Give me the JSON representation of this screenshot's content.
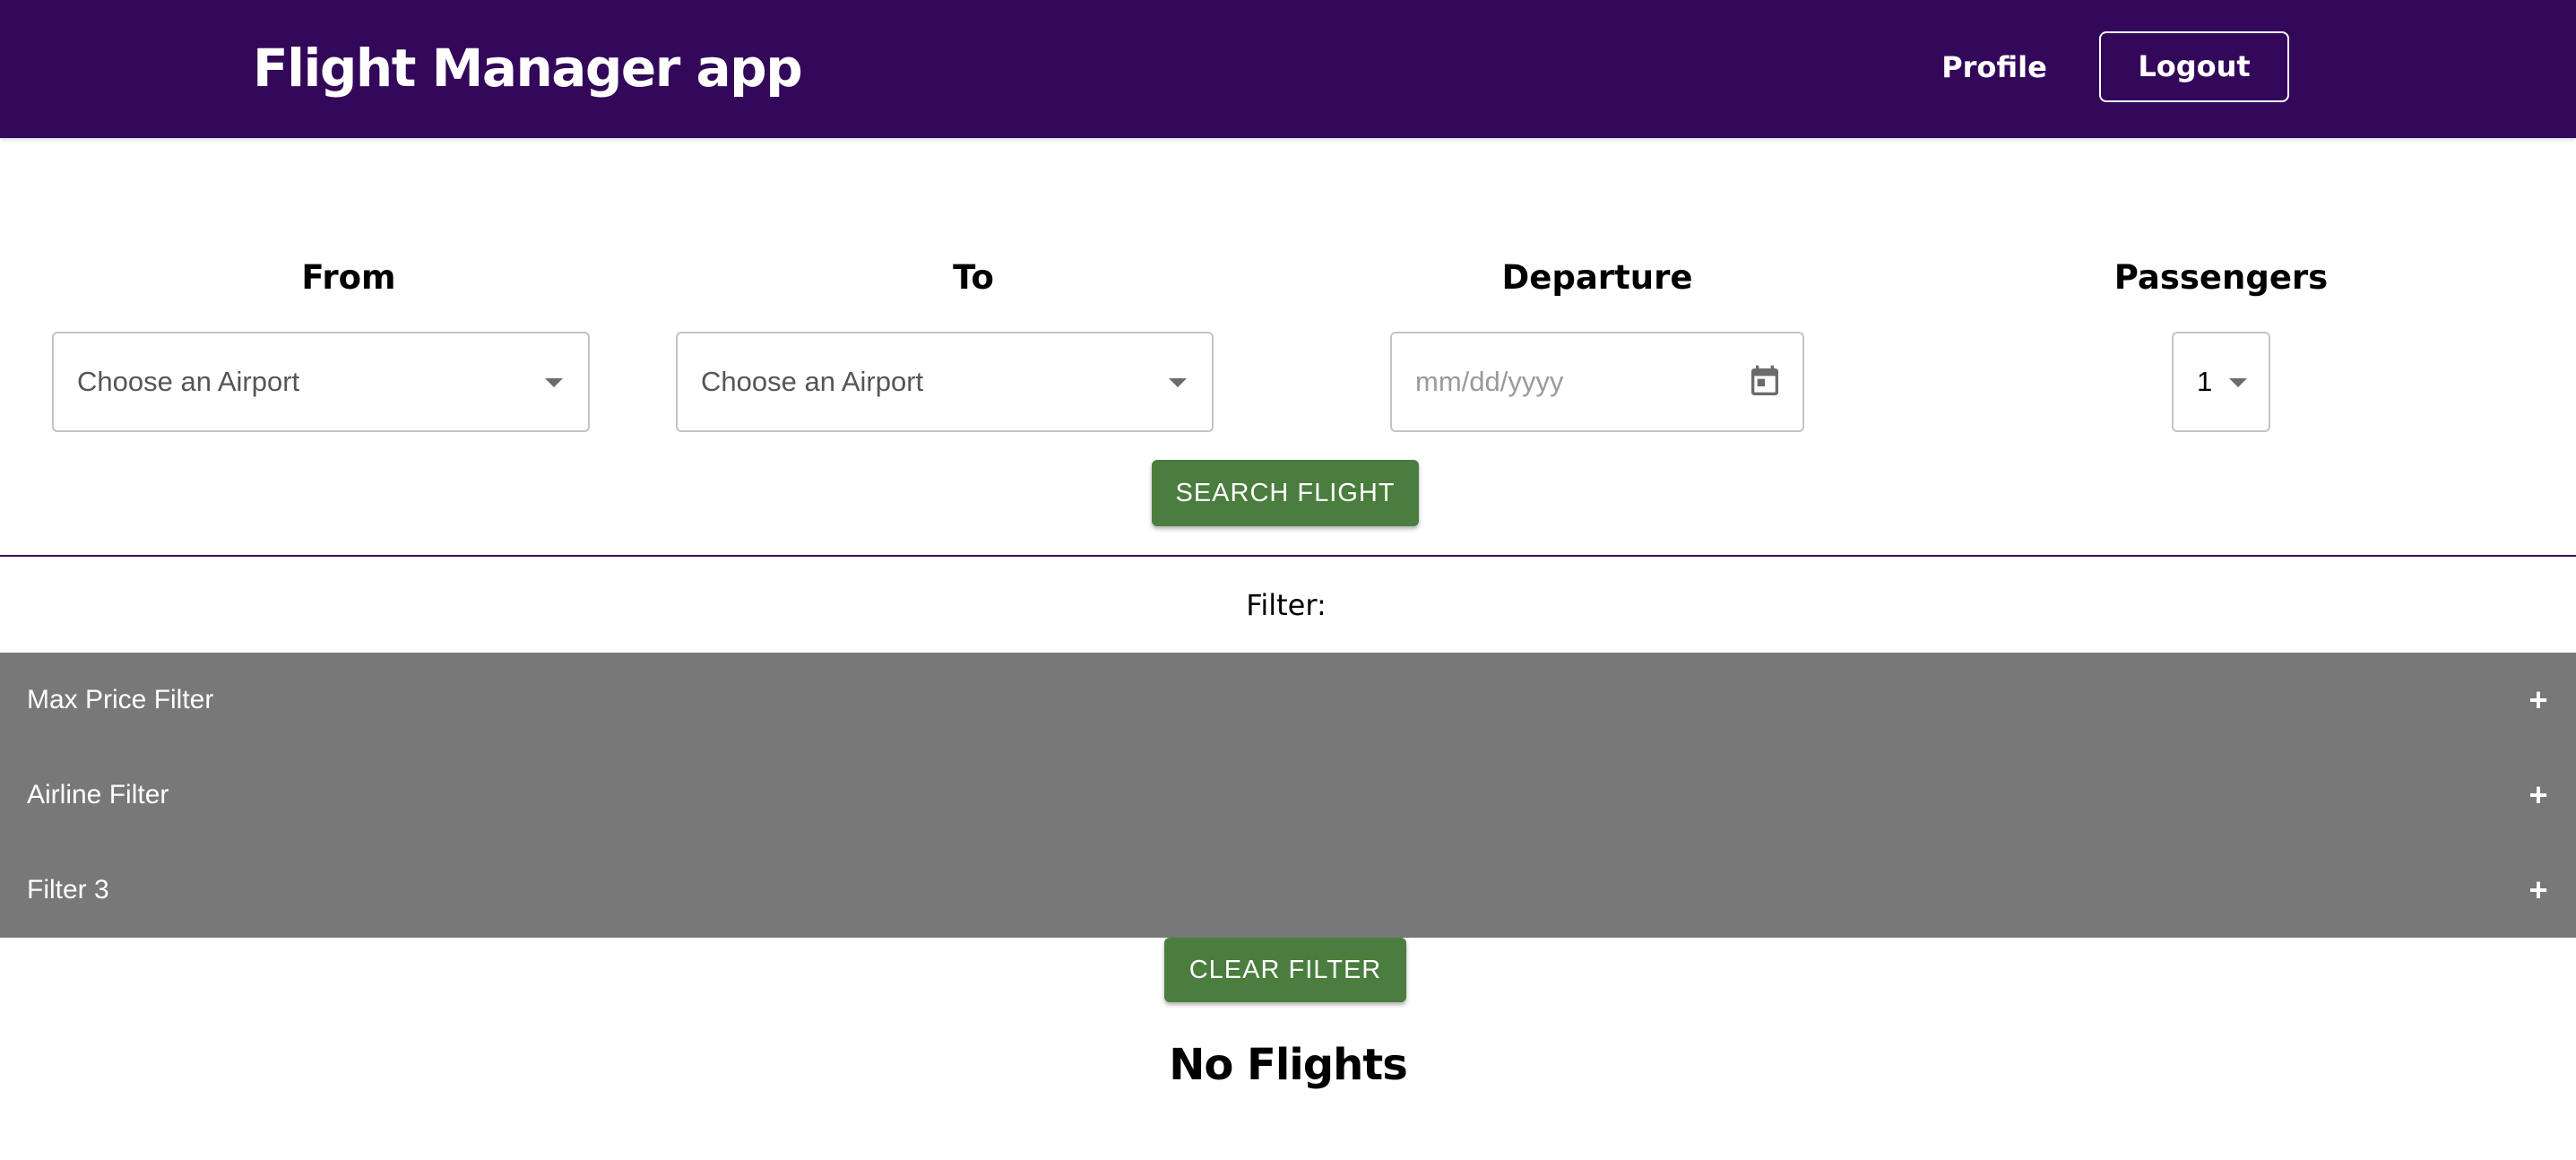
{
  "header": {
    "brand": "Flight Manager app",
    "profile_label": "Profile",
    "logout_label": "Logout"
  },
  "search": {
    "from": {
      "label": "From",
      "value": "Choose an Airport"
    },
    "to": {
      "label": "To",
      "value": "Choose an Airport"
    },
    "departure": {
      "label": "Departure",
      "placeholder": "mm/dd/yyyy"
    },
    "passengers": {
      "label": "Passengers",
      "value": "1"
    },
    "search_button": "SEARCH FLIGHT"
  },
  "filters": {
    "title": "Filter:",
    "items": [
      {
        "label": "Max Price Filter",
        "icon": "+"
      },
      {
        "label": "Airline Filter",
        "icon": "+"
      },
      {
        "label": "Filter 3",
        "icon": "+"
      }
    ],
    "clear_button": "CLEAR FILTER"
  },
  "results": {
    "message": "No Flights"
  },
  "colors": {
    "header_bg": "#33075a",
    "button_green": "#4a7d3e",
    "accordion_bg": "#787878"
  }
}
